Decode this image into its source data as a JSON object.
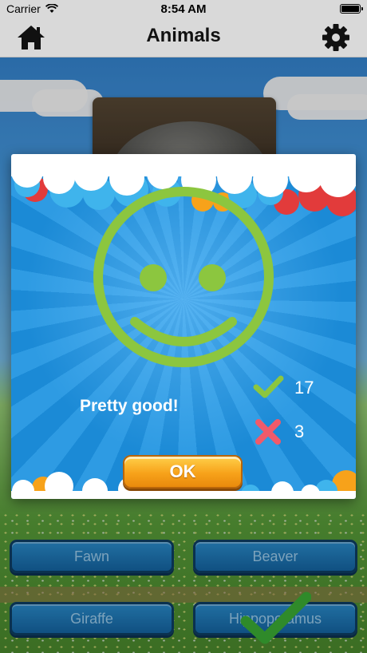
{
  "status_bar": {
    "carrier": "Carrier",
    "time": "8:54 AM"
  },
  "nav": {
    "title": "Animals",
    "home_icon": "home-icon",
    "settings_icon": "gear-icon"
  },
  "dialog": {
    "face_icon": "smiley-face-icon",
    "message": "Pretty good!",
    "correct_count": "17",
    "wrong_count": "3",
    "ok_label": "OK",
    "face_color": "#8cc63f",
    "correct_color": "#8cc63f",
    "wrong_color": "#f05a6a"
  },
  "answers": [
    {
      "label": "Fawn"
    },
    {
      "label": "Beaver"
    },
    {
      "label": "Giraffe"
    },
    {
      "label": "Hippopotamus"
    }
  ]
}
